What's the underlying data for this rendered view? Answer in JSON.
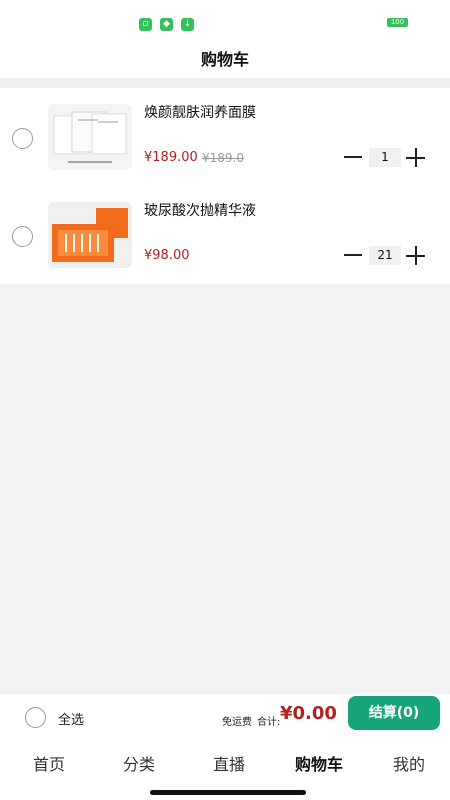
{
  "status_bar": {
    "icons": [
      "message-icon",
      "shield-icon",
      "download-icon"
    ],
    "battery": "100"
  },
  "header": {
    "title": "购物车"
  },
  "cart": {
    "items": [
      {
        "name": "焕颜靓肤润养面膜",
        "price": "¥189.00",
        "old_price": "¥189.0",
        "quantity": "1",
        "image": "white facial mask product box",
        "selected": false
      },
      {
        "name": "玻尿酸次抛精华液",
        "price": "¥98.00",
        "quantity": "21",
        "image": "orange serum gift box",
        "selected": false
      }
    ]
  },
  "checkout": {
    "select_all_label": "全选",
    "shipping_label": "免运费",
    "total_label": "合计:",
    "total_amount": "¥0.00",
    "checkout_button": "结算(0)"
  },
  "tabs": [
    {
      "label": "首页",
      "active": false
    },
    {
      "label": "分类",
      "active": false
    },
    {
      "label": "直播",
      "active": false
    },
    {
      "label": "购物车",
      "active": true
    },
    {
      "label": "我的",
      "active": false
    }
  ],
  "colors": {
    "price": "#b22222",
    "checkout_button": "#16a57a",
    "background": "#f1f2f4"
  }
}
